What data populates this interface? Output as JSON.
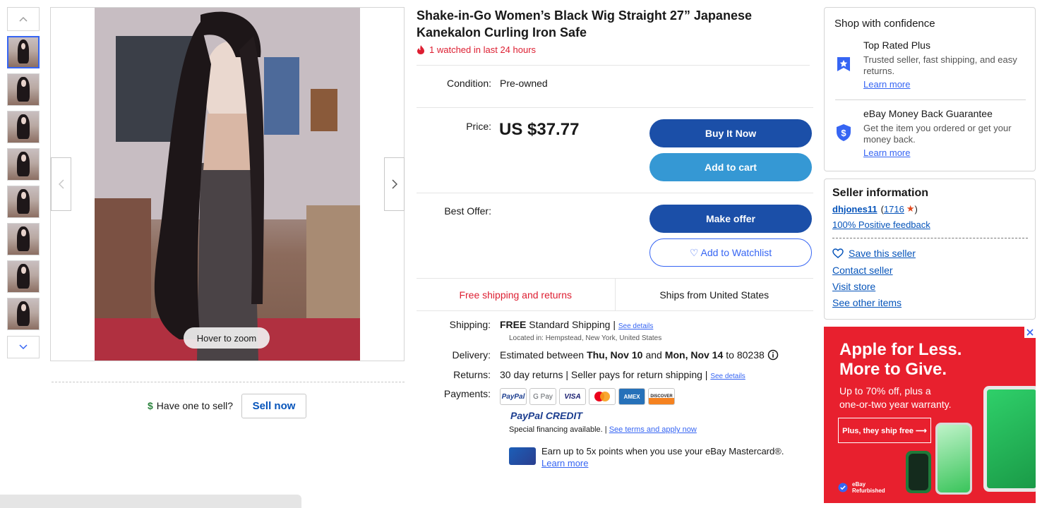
{
  "product": {
    "title": "Shake-in-Go Women’s Black Wig Straight 27” Japanese Kanekalon Curling Iron Safe",
    "watch_text": "1 watched in last 24 hours",
    "condition_label": "Condition:",
    "condition_value": "Pre-owned",
    "price_label": "Price:",
    "price_value": "US $37.77",
    "best_offer_label": "Best Offer:"
  },
  "gallery": {
    "thumbnail_count": 8,
    "selected_index": 0,
    "zoom_hint": "Hover to zoom"
  },
  "sell": {
    "prompt": "Have one to sell?",
    "button": "Sell now"
  },
  "buttons": {
    "buy_now": "Buy It Now",
    "add_to_cart": "Add to cart",
    "make_offer": "Make offer",
    "watchlist": "♡ Add to Watchlist"
  },
  "shipping_banner": {
    "free": "Free shipping and returns",
    "ships_from": "Ships from United States"
  },
  "details": {
    "shipping_label": "Shipping:",
    "shipping_free": "FREE",
    "shipping_text": "Standard Shipping |",
    "shipping_link": "See details",
    "located": "Located in: Hempstead, New York, United States",
    "delivery_label": "Delivery:",
    "delivery_prefix": "Estimated between",
    "delivery_start": "Thu, Nov 10",
    "delivery_and": "and",
    "delivery_end": "Mon, Nov 14",
    "delivery_zip": "to 80238",
    "returns_label": "Returns:",
    "returns_text": "30 day returns | Seller pays for return shipping |",
    "returns_link": "See details",
    "payments_label": "Payments:",
    "payment_methods": [
      "PayPal",
      "G Pay",
      "VISA",
      "Mastercard",
      "AMEX",
      "DISCOVER"
    ],
    "paypal_credit": "PayPal CREDIT",
    "financing_text": "Special financing available. |",
    "financing_link": "See terms and apply now",
    "mastercard_text": "Earn up to 5x points when you use your eBay Mastercard®.",
    "mastercard_link": "Learn more"
  },
  "confidence": {
    "heading": "Shop with confidence",
    "items": [
      {
        "title": "Top Rated Plus",
        "text": "Trusted seller, fast shipping, and easy returns.",
        "link": "Learn more"
      },
      {
        "title": "eBay Money Back Guarantee",
        "text": "Get the item you ordered or get your money back.",
        "link": "Learn more"
      }
    ]
  },
  "seller": {
    "heading": "Seller information",
    "name": "dhjones11",
    "feedback_count": "1716",
    "positive": "100% Positive feedback",
    "save": "Save this seller",
    "contact": "Contact seller",
    "visit": "Visit store",
    "other": "See other items"
  },
  "ad": {
    "headline_1": "Apple for Less.",
    "headline_2": "More to Give.",
    "sub_1": "Up to 70% off, plus a",
    "sub_2": "one-or-two year warranty.",
    "cta": "Plus, they ship free ⟶",
    "brand_1": "eBay",
    "brand_2": "Refurbished"
  },
  "colors": {
    "accent": "#3665f3",
    "buy_button": "#1b4fa8",
    "cart_button": "#3598d4",
    "alert_red": "#dd1e31",
    "ad_red": "#e8202e"
  }
}
